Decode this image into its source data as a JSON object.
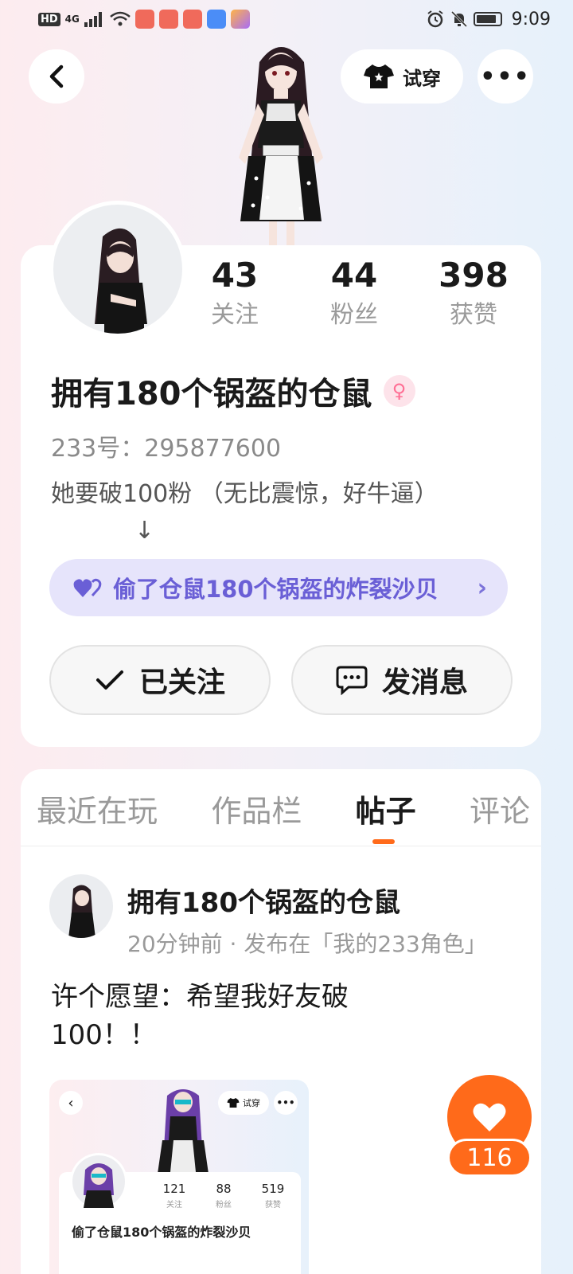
{
  "status_bar": {
    "network": "4G",
    "time": "9:09"
  },
  "header": {
    "try_on_label": "试穿",
    "more_label": "•••"
  },
  "profile": {
    "stats": [
      {
        "value": "43",
        "label": "关注"
      },
      {
        "value": "44",
        "label": "粉丝"
      },
      {
        "value": "398",
        "label": "获赞"
      }
    ],
    "nickname": "拥有180个锅盔的仓鼠",
    "gender_symbol": "♀",
    "uid": "233号：295877600",
    "bio": "她要破100粉 （无比震惊，好牛逼）\n           ↓",
    "cp_label": "偷了仓鼠180个锅盔的炸裂沙贝",
    "follow_label": "已关注",
    "message_label": "发消息"
  },
  "tabs": [
    {
      "label": "最近在玩",
      "active": false
    },
    {
      "label": "作品栏",
      "active": false
    },
    {
      "label": "帖子",
      "active": true
    },
    {
      "label": "评论",
      "active": false
    }
  ],
  "post": {
    "author": "拥有180个锅盔的仓鼠",
    "meta": "20分钟前 · 发布在「我的233角色」",
    "text": "许个愿望：希望我好友破100！！",
    "thumbnail": {
      "try_on_label": "试穿",
      "stats": [
        {
          "value": "121",
          "label": "关注"
        },
        {
          "value": "88",
          "label": "粉丝"
        },
        {
          "value": "519",
          "label": "获赞"
        }
      ],
      "name": "偷了仓鼠180个锅盔的炸裂沙贝"
    },
    "like_count": "116"
  },
  "colors": {
    "accent": "#ff6a1a",
    "cp_text": "#6a5fd6",
    "cp_bg": "#e6e4fb",
    "gender_pink": "#ff6f95"
  },
  "icons": [
    "back-icon",
    "tshirt-icon",
    "more-icon",
    "check-icon",
    "chat-icon",
    "heart-icon",
    "chevron-right-icon"
  ]
}
